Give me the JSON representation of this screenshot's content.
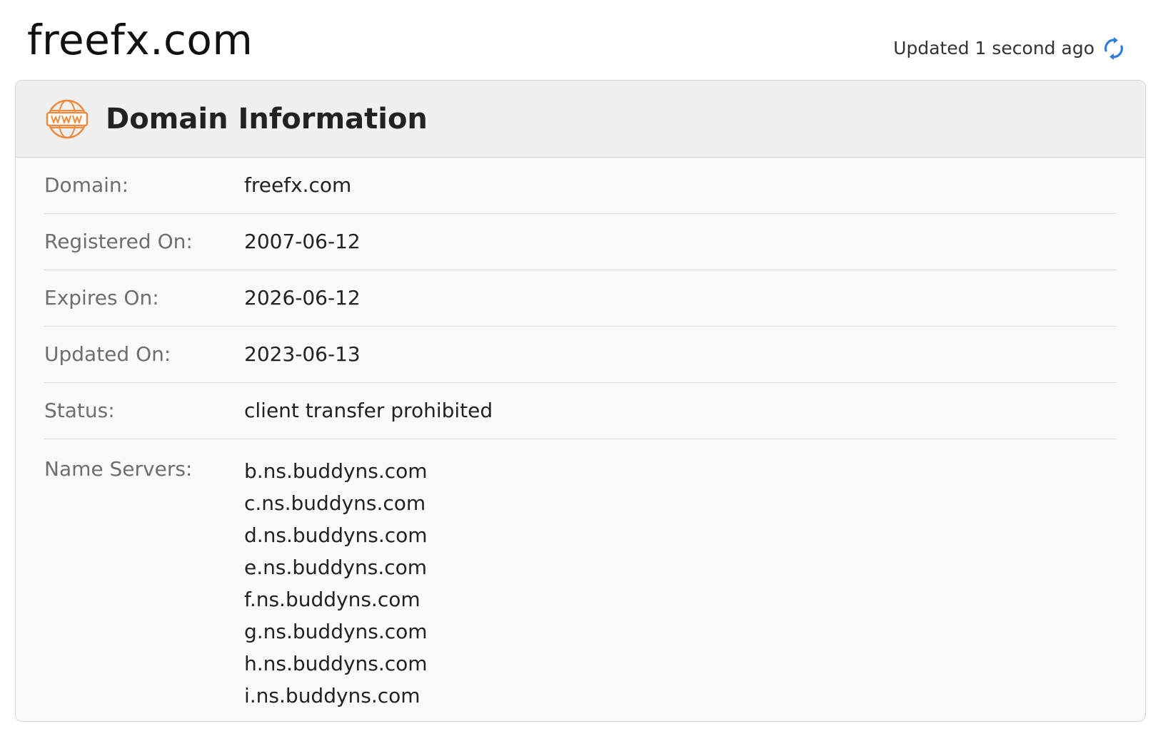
{
  "site_title": "freefx.com",
  "updated_text": "Updated 1 second ago",
  "card": {
    "title": "Domain Information",
    "icon": "www-icon",
    "icon_color": "#f08a3e"
  },
  "rows": [
    {
      "label": "Domain:",
      "value": "freefx.com"
    },
    {
      "label": "Registered On:",
      "value": "2007-06-12"
    },
    {
      "label": "Expires On:",
      "value": "2026-06-12"
    },
    {
      "label": "Updated On:",
      "value": "2023-06-13"
    },
    {
      "label": "Status:",
      "value": "client transfer prohibited"
    }
  ],
  "name_servers": {
    "label": "Name Servers:",
    "items": [
      "b.ns.buddyns.com",
      "c.ns.buddyns.com",
      "d.ns.buddyns.com",
      "e.ns.buddyns.com",
      "f.ns.buddyns.com",
      "g.ns.buddyns.com",
      "h.ns.buddyns.com",
      "i.ns.buddyns.com"
    ]
  },
  "colors": {
    "accent_blue": "#2f7fd6",
    "icon_orange": "#f08a3e"
  }
}
